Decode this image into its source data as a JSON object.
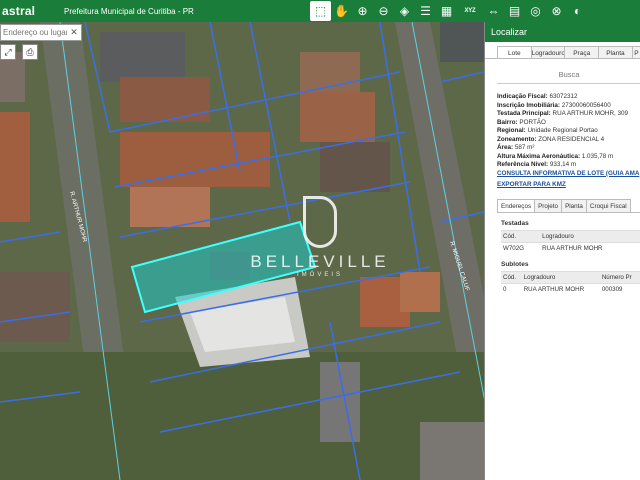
{
  "header": {
    "brand": "astral",
    "org": "Prefeitura Municipal de Curitiba - PR",
    "tools": [
      {
        "icon": "identify-icon",
        "glyph": "⬚",
        "active": true
      },
      {
        "icon": "pan-hand-icon",
        "glyph": "✋"
      },
      {
        "icon": "zoom-in-icon",
        "glyph": "⊕"
      },
      {
        "icon": "zoom-out-icon",
        "glyph": "⊖"
      },
      {
        "icon": "layers-icon",
        "glyph": "◈"
      },
      {
        "icon": "list-icon",
        "glyph": "☰"
      },
      {
        "icon": "grid-icon",
        "glyph": "▦"
      },
      {
        "icon": "xyz-text-icon",
        "glyph": "XYZ"
      },
      {
        "icon": "measure-icon",
        "glyph": "⇔"
      },
      {
        "icon": "ruler-icon",
        "glyph": "▤"
      },
      {
        "icon": "target-icon",
        "glyph": "◎"
      },
      {
        "icon": "globe-icon",
        "glyph": "⊗"
      },
      {
        "icon": "basemap-icon",
        "glyph": "◐"
      }
    ]
  },
  "search": {
    "placeholder": "Endereço ou lugar"
  },
  "map": {
    "streets": [
      "R. ARTHUR MOHR",
      "R. MIGUEL CALUF"
    ],
    "watermark": {
      "name": "BELLEVILLE",
      "sub": "IMÓVEIS"
    }
  },
  "panel": {
    "title": "Localizar",
    "tabs": [
      "Lote",
      "Logradouro",
      "Praça",
      "Planta",
      "P"
    ],
    "busca_label": "Busca",
    "fields": [
      {
        "label": "Indicação Fiscal:",
        "value": "63072312"
      },
      {
        "label": "Inscrição Imobiliária:",
        "value": "27300060056400"
      },
      {
        "label": "Testada Principal:",
        "value": "RUA ARTHUR MOHR, 309"
      },
      {
        "label": "Bairro:",
        "value": "PORTÃO"
      },
      {
        "label": "Regional:",
        "value": "Unidade Regional Portao"
      },
      {
        "label": "Zoneamento:",
        "value": "ZONA RESIDENCIAL 4"
      },
      {
        "label": "Área:",
        "value": "587 m²"
      },
      {
        "label": "Altura Máxima Aeronáutica:",
        "value": "1.035,78 m"
      },
      {
        "label": "Referência Nível:",
        "value": "933,14 m"
      }
    ],
    "consulta_link": "CONSULTA INFORMATIVA DE LOTE (GUIA AMA",
    "kmz_link": "EXPORTAR PARA KMZ",
    "subtabs": [
      "Endereços",
      "Projeto",
      "Planta",
      "Croqui Fiscal"
    ],
    "testadas": {
      "title": "Testadas",
      "headers": [
        "Cód.",
        "Logradouro"
      ],
      "rows": [
        [
          "W702G",
          "RUA ARTHUR MOHR"
        ]
      ]
    },
    "sublotes": {
      "title": "Sublotes",
      "headers": [
        "Cód.",
        "Logradouro",
        "Número Pr"
      ],
      "rows": [
        [
          "0",
          "RUA ARTHUR MOHR",
          "000309"
        ]
      ]
    }
  }
}
